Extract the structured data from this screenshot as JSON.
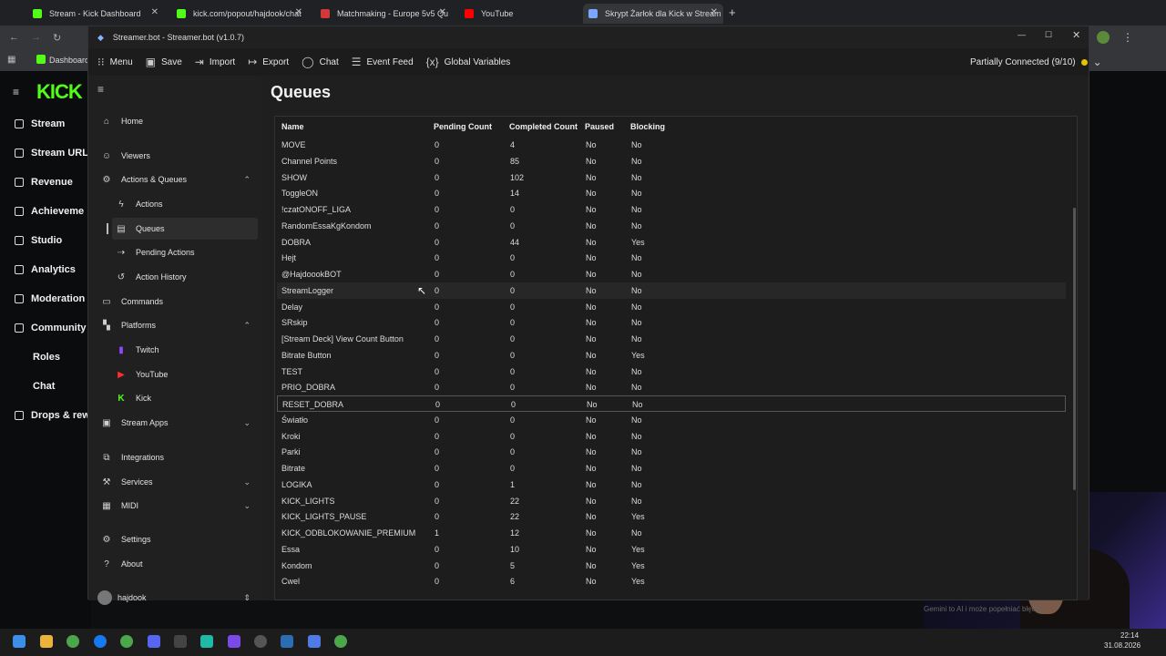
{
  "browser": {
    "tabs": [
      {
        "label": "Stream - Kick Dashboard",
        "color": "#53fc18"
      },
      {
        "label": "kick.com/popout/hajdook/chat",
        "color": "#53fc18"
      },
      {
        "label": "Matchmaking - Europe 5v5 Qu",
        "color": "#d23a3a"
      },
      {
        "label": "YouTube",
        "color": "#ff0000"
      },
      {
        "label": "Skrypt Żarłok dla Kick w Stream",
        "color": "#7aa7ff"
      }
    ],
    "bookmark": "Dashboard"
  },
  "kick": {
    "logo": "KICK",
    "nav": [
      "Stream",
      "Stream URL",
      "Revenue",
      "Achieveme",
      "Studio",
      "Analytics",
      "Moderation",
      "Community",
      "Roles",
      "Chat",
      "Drops & rew"
    ]
  },
  "window": {
    "title": "Streamer.bot - Streamer.bot (v1.0.7)",
    "toolbar": {
      "menu": "Menu",
      "save": "Save",
      "import": "Import",
      "export": "Export",
      "chat": "Chat",
      "event_feed": "Event Feed",
      "global_variables": "Global Variables",
      "connection": "Partially Connected (9/10)"
    }
  },
  "sidebar": {
    "home": "Home",
    "viewers": "Viewers",
    "actions_queues": "Actions & Queues",
    "actions": "Actions",
    "queues": "Queues",
    "pending_actions": "Pending Actions",
    "action_history": "Action History",
    "commands": "Commands",
    "platforms": "Platforms",
    "twitch": "Twitch",
    "youtube": "YouTube",
    "kick": "Kick",
    "stream_apps": "Stream Apps",
    "integrations": "Integrations",
    "services": "Services",
    "midi": "MIDI",
    "settings": "Settings",
    "about": "About",
    "user": "hajdook"
  },
  "page_title": "Queues",
  "table": {
    "headers": [
      "Name",
      "Pending Count",
      "Completed Count",
      "Paused",
      "Blocking"
    ],
    "rows": [
      [
        "MOVE",
        "0",
        "4",
        "No",
        "No"
      ],
      [
        "Channel Points",
        "0",
        "85",
        "No",
        "No"
      ],
      [
        "SHOW",
        "0",
        "102",
        "No",
        "No"
      ],
      [
        "ToggleON",
        "0",
        "14",
        "No",
        "No"
      ],
      [
        "!czatONOFF_LIGA",
        "0",
        "0",
        "No",
        "No"
      ],
      [
        "RandomEssaKgKondom",
        "0",
        "0",
        "No",
        "No"
      ],
      [
        "DOBRA",
        "0",
        "44",
        "No",
        "Yes"
      ],
      [
        "Hejt",
        "0",
        "0",
        "No",
        "No"
      ],
      [
        "@HajdoookBOT",
        "0",
        "0",
        "No",
        "No"
      ],
      [
        "StreamLogger",
        "0",
        "0",
        "No",
        "No"
      ],
      [
        "Delay",
        "0",
        "0",
        "No",
        "No"
      ],
      [
        "SRskip",
        "0",
        "0",
        "No",
        "No"
      ],
      [
        "[Stream Deck] View Count Button",
        "0",
        "0",
        "No",
        "No"
      ],
      [
        "Bitrate Button",
        "0",
        "0",
        "No",
        "Yes"
      ],
      [
        "TEST",
        "0",
        "0",
        "No",
        "No"
      ],
      [
        "PRIO_DOBRA",
        "0",
        "0",
        "No",
        "No"
      ],
      [
        "RESET_DOBRA",
        "0",
        "0",
        "No",
        "No"
      ],
      [
        "Światło",
        "0",
        "0",
        "No",
        "No"
      ],
      [
        "Kroki",
        "0",
        "0",
        "No",
        "No"
      ],
      [
        "Parki",
        "0",
        "0",
        "No",
        "No"
      ],
      [
        "Bitrate",
        "0",
        "0",
        "No",
        "No"
      ],
      [
        "LOGIKA",
        "0",
        "1",
        "No",
        "No"
      ],
      [
        "KICK_LIGHTS",
        "0",
        "22",
        "No",
        "No"
      ],
      [
        "KICK_LIGHTS_PAUSE",
        "0",
        "22",
        "No",
        "Yes"
      ],
      [
        "KICK_ODBLOKOWANIE_PREMIUM",
        "1",
        "12",
        "No",
        "No"
      ],
      [
        "Essa",
        "0",
        "10",
        "No",
        "Yes"
      ],
      [
        "Kondom",
        "0",
        "5",
        "No",
        "Yes"
      ],
      [
        "Cwel",
        "0",
        "6",
        "No",
        "Yes"
      ]
    ]
  },
  "overlay": {
    "gemini_note": "Gemini to AI i może popełniać błędy."
  },
  "clock": {
    "time": "22:14",
    "date": "31.08.2026"
  }
}
